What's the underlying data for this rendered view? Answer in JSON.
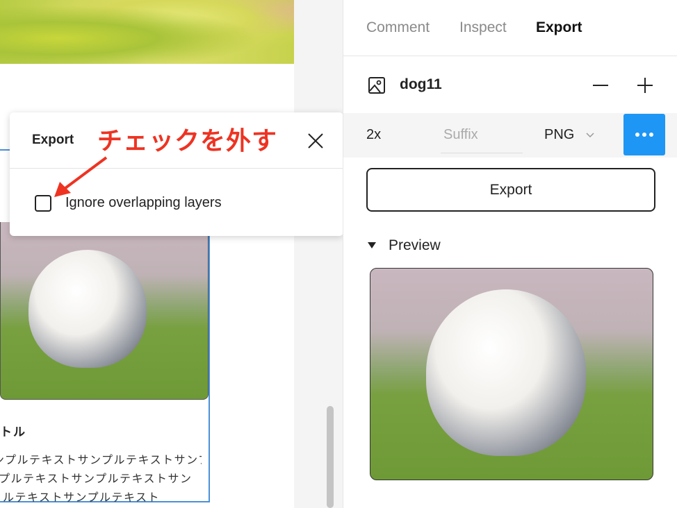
{
  "canvas": {
    "card_title": "トル",
    "card_text_lines": [
      "ンプルテキストサンプルテキストサンプルテキストサ",
      "プルテキストサンプルテキストサン",
      "ルテキストサンプルテキスト"
    ]
  },
  "popup": {
    "title": "Export",
    "checkbox_label": "Ignore overlapping layers",
    "checkbox_checked": false
  },
  "annotation": {
    "text": "チェックを外す",
    "color": "#ee3322"
  },
  "panel": {
    "tabs": [
      {
        "label": "Comment"
      },
      {
        "label": "Inspect"
      },
      {
        "label": "Export",
        "active": true
      }
    ],
    "layer_name": "dog11",
    "export_setting": {
      "scale": "2x",
      "suffix_placeholder": "Suffix",
      "format": "PNG"
    },
    "export_button": "Export",
    "preview_label": "Preview",
    "accent": "#1e96f5"
  }
}
